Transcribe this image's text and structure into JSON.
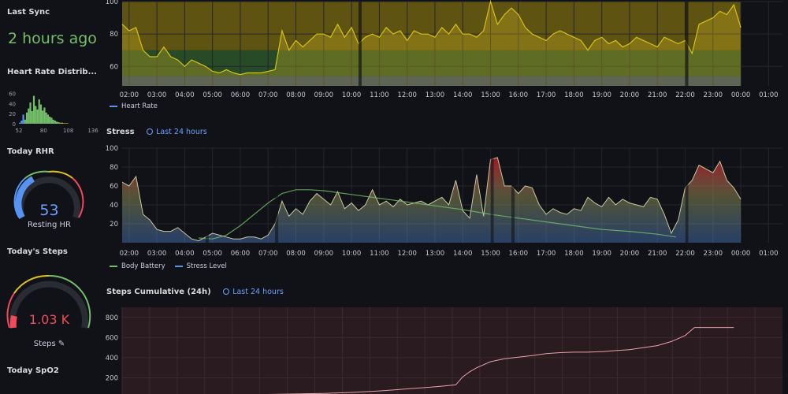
{
  "sidebar": {
    "last_sync_title": "Last Sync",
    "last_sync_value": "2 hours ago",
    "hr_dist_title": "Heart Rate Distrib...",
    "hr_dist_ticks_y": [
      "60",
      "40",
      "20",
      "0"
    ],
    "hr_dist_ticks_x": [
      "52",
      "80",
      "108",
      "136"
    ],
    "rhr_title": "Today RHR",
    "rhr_value": "53",
    "rhr_label": "Resting HR",
    "steps_title": "Today's Steps",
    "steps_value": "1.03 K",
    "steps_label": "Steps ✎",
    "spo2_title": "Today SpO2"
  },
  "colors": {
    "green": "#73bf69",
    "yellow": "#e0c414",
    "red": "#f2495c",
    "blue": "#5794f2",
    "accent_link": "#6e9fff"
  },
  "hr_panel": {
    "legend": [
      "Heart Rate"
    ],
    "time_ticks": [
      "02:00",
      "03:00",
      "04:00",
      "05:00",
      "06:00",
      "07:00",
      "08:00",
      "09:00",
      "10:00",
      "11:00",
      "12:00",
      "13:00",
      "14:00",
      "15:00",
      "16:00",
      "17:00",
      "18:00",
      "19:00",
      "20:00",
      "21:00",
      "22:00",
      "23:00",
      "00:00",
      "01:00"
    ],
    "y_ticks": [
      "100",
      "80",
      "60"
    ]
  },
  "stress_panel": {
    "title": "Stress",
    "time_range": "Last 24 hours",
    "legend": [
      "Body Battery",
      "Stress Level"
    ],
    "time_ticks": [
      "02:00",
      "03:00",
      "04:00",
      "05:00",
      "06:00",
      "07:00",
      "08:00",
      "09:00",
      "10:00",
      "11:00",
      "12:00",
      "13:00",
      "14:00",
      "15:00",
      "16:00",
      "17:00",
      "18:00",
      "19:00",
      "20:00",
      "21:00",
      "22:00",
      "23:00",
      "00:00",
      "01:00"
    ],
    "y_ticks": [
      "100",
      "80",
      "60",
      "40",
      "20"
    ]
  },
  "steps_panel": {
    "title": "Steps Cumulative (24h)",
    "time_range": "Last 24 hours",
    "y_ticks": [
      "800",
      "600",
      "400",
      "200"
    ]
  },
  "chart_data": [
    {
      "type": "bar",
      "title": "Heart Rate Distrib...",
      "categories": [
        52,
        54,
        56,
        58,
        60,
        62,
        64,
        66,
        68,
        70,
        72,
        74,
        76,
        78,
        80,
        82,
        84,
        86,
        88,
        90,
        92,
        94,
        96,
        98,
        100,
        102,
        104,
        106,
        108
      ],
      "values": [
        2,
        6,
        18,
        8,
        22,
        30,
        42,
        25,
        55,
        35,
        28,
        48,
        38,
        26,
        32,
        22,
        18,
        14,
        12,
        8,
        6,
        4,
        3,
        2,
        2,
        1,
        1,
        1,
        0
      ],
      "ylim": [
        0,
        70
      ],
      "xlim": [
        52,
        136
      ]
    },
    {
      "type": "line",
      "title": "",
      "ylabel": "",
      "x_range": [
        "01:45",
        "01:30"
      ],
      "ylim": [
        48,
        100
      ],
      "series": [
        {
          "name": "Heart Rate",
          "x": [
            "01:45",
            "02:00",
            "02:15",
            "02:30",
            "02:45",
            "03:00",
            "03:15",
            "03:30",
            "03:45",
            "04:00",
            "04:15",
            "04:30",
            "04:45",
            "05:00",
            "05:15",
            "05:30",
            "05:45",
            "06:00",
            "06:15",
            "06:30",
            "06:45",
            "07:00",
            "07:15",
            "07:30",
            "07:45",
            "08:00",
            "08:15",
            "08:30",
            "08:45",
            "09:00",
            "09:15",
            "09:30",
            "09:45",
            "10:00",
            "10:15",
            "10:30",
            "10:45",
            "11:00",
            "11:15",
            "11:30",
            "11:45",
            "12:00",
            "12:15",
            "12:30",
            "12:45",
            "13:00",
            "13:15",
            "13:30",
            "13:45",
            "14:00",
            "14:15",
            "14:30",
            "14:45",
            "15:00",
            "15:15",
            "15:30",
            "15:45",
            "16:00",
            "16:15",
            "16:30",
            "16:45",
            "17:00",
            "17:15",
            "17:30",
            "17:45",
            "18:00",
            "18:15",
            "18:30",
            "18:45",
            "19:00",
            "19:15",
            "19:30",
            "19:45",
            "20:00",
            "20:15",
            "20:30",
            "20:45",
            "21:00",
            "21:15",
            "21:30",
            "21:45",
            "22:00",
            "22:15",
            "22:30",
            "22:45",
            "23:00",
            "23:15",
            "23:30",
            "23:45",
            "00:00"
          ],
          "values": [
            86,
            82,
            84,
            70,
            66,
            66,
            72,
            66,
            64,
            60,
            64,
            62,
            60,
            57,
            56,
            58,
            56,
            55,
            56,
            56,
            56,
            57,
            58,
            82,
            70,
            76,
            72,
            76,
            80,
            80,
            78,
            86,
            78,
            84,
            74,
            78,
            80,
            78,
            84,
            80,
            82,
            76,
            82,
            80,
            80,
            78,
            84,
            80,
            86,
            80,
            80,
            78,
            82,
            100,
            86,
            92,
            96,
            92,
            84,
            80,
            78,
            76,
            80,
            82,
            80,
            78,
            76,
            70,
            76,
            78,
            74,
            76,
            72,
            74,
            78,
            76,
            74,
            72,
            78,
            76,
            74,
            76,
            68,
            86,
            88,
            90,
            94,
            92,
            98,
            84
          ]
        }
      ]
    },
    {
      "type": "line",
      "title": "Stress",
      "x_range": [
        "01:45",
        "01:30"
      ],
      "ylim": [
        0,
        100
      ],
      "series": [
        {
          "name": "Stress Level",
          "x": [
            "01:45",
            "02:00",
            "02:15",
            "02:30",
            "02:45",
            "03:00",
            "03:15",
            "03:30",
            "03:45",
            "04:00",
            "04:15",
            "04:30",
            "04:45",
            "05:00",
            "05:15",
            "05:30",
            "05:45",
            "06:00",
            "06:15",
            "06:30",
            "06:45",
            "07:00",
            "07:15",
            "07:30",
            "07:45",
            "08:00",
            "08:15",
            "08:30",
            "08:45",
            "09:00",
            "09:15",
            "09:30",
            "09:45",
            "10:00",
            "10:15",
            "10:30",
            "10:45",
            "11:00",
            "11:15",
            "11:30",
            "11:45",
            "12:00",
            "12:15",
            "12:30",
            "12:45",
            "13:00",
            "13:15",
            "13:30",
            "13:45",
            "14:00",
            "14:15",
            "14:30",
            "14:45",
            "15:00",
            "15:15",
            "15:30",
            "15:45",
            "16:00",
            "16:15",
            "16:30",
            "16:45",
            "17:00",
            "17:15",
            "17:30",
            "17:45",
            "18:00",
            "18:15",
            "18:30",
            "18:45",
            "19:00",
            "19:15",
            "19:30",
            "19:45",
            "20:00",
            "20:15",
            "20:30",
            "20:45",
            "21:00",
            "21:15",
            "21:30",
            "21:45",
            "22:00",
            "22:15",
            "22:30",
            "22:45",
            "23:00",
            "23:15",
            "23:30",
            "23:45",
            "00:00"
          ],
          "values": [
            64,
            60,
            70,
            30,
            24,
            14,
            12,
            12,
            16,
            10,
            4,
            2,
            6,
            10,
            8,
            6,
            4,
            4,
            6,
            6,
            4,
            8,
            20,
            44,
            28,
            36,
            30,
            44,
            52,
            46,
            40,
            54,
            36,
            42,
            34,
            40,
            56,
            40,
            44,
            38,
            46,
            40,
            42,
            44,
            40,
            44,
            48,
            40,
            66,
            34,
            26,
            72,
            28,
            88,
            90,
            60,
            60,
            52,
            60,
            58,
            40,
            30,
            36,
            32,
            30,
            36,
            34,
            48,
            42,
            38,
            48,
            40,
            46,
            42,
            40,
            38,
            48,
            46,
            30,
            10,
            24,
            58,
            66,
            82,
            78,
            74,
            86,
            66,
            58,
            46
          ]
        },
        {
          "name": "Body Battery",
          "x": [
            "04:30",
            "05:00",
            "05:30",
            "06:00",
            "06:30",
            "07:00",
            "07:30",
            "08:00",
            "08:30",
            "09:00",
            "09:30",
            "10:00",
            "11:00",
            "12:00",
            "13:00",
            "14:00",
            "15:00",
            "16:00",
            "17:00",
            "18:00",
            "19:00",
            "20:00",
            "21:00",
            "21:40"
          ],
          "values": [
            5,
            4,
            8,
            18,
            30,
            42,
            52,
            56,
            56,
            55,
            53,
            51,
            47,
            43,
            39,
            35,
            30,
            26,
            22,
            18,
            14,
            12,
            9,
            6
          ]
        }
      ]
    },
    {
      "type": "line",
      "title": "Steps Cumulative (24h)",
      "x_range": [
        "01:45",
        "01:30"
      ],
      "ylim": [
        0,
        900
      ],
      "series": [
        {
          "name": "",
          "x": [
            "02:00",
            "04:00",
            "06:00",
            "07:00",
            "08:00",
            "09:00",
            "10:00",
            "11:00",
            "12:00",
            "13:00",
            "13:45",
            "14:00",
            "14:15",
            "14:30",
            "15:00",
            "15:30",
            "16:00",
            "16:30",
            "17:00",
            "17:30",
            "18:00",
            "18:30",
            "19:00",
            "19:30",
            "20:00",
            "20:30",
            "21:00",
            "21:30",
            "22:00",
            "22:20",
            "23:00",
            "23:45"
          ],
          "values": [
            30,
            30,
            30,
            35,
            40,
            45,
            55,
            70,
            90,
            110,
            130,
            210,
            260,
            300,
            360,
            390,
            405,
            420,
            440,
            450,
            455,
            455,
            460,
            470,
            480,
            500,
            520,
            560,
            620,
            700,
            700,
            700
          ]
        }
      ]
    }
  ]
}
